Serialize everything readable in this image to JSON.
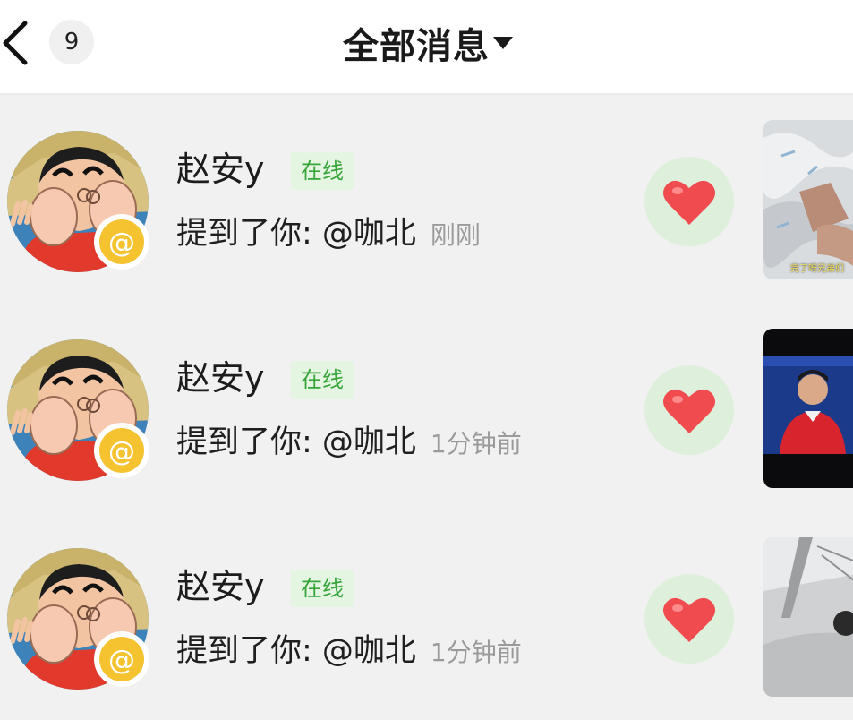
{
  "header": {
    "unread_count": "9",
    "title": "全部消息"
  },
  "messages": [
    {
      "user_name": "赵安y",
      "status": "在线",
      "action": "提到了你: @咖北",
      "time": "刚刚",
      "thumbnail_caption": "完了呀兄弟们",
      "thumbnail_icon": "blanket-photo-icon"
    },
    {
      "user_name": "赵安y",
      "status": "在线",
      "action": "提到了你: @咖北",
      "time": "1分钟前",
      "thumbnail_icon": "presenter-video-icon"
    },
    {
      "user_name": "赵安y",
      "status": "在线",
      "action": "提到了你: @咖北",
      "time": "1分钟前",
      "thumbnail_icon": "street-photo-icon"
    }
  ],
  "colors": {
    "accent_green": "#38a53a",
    "badge_bg": "#e4f5e2",
    "like_bg": "#def0db",
    "heart": "#f04b4f",
    "mention_yellow": "#f5c230"
  }
}
